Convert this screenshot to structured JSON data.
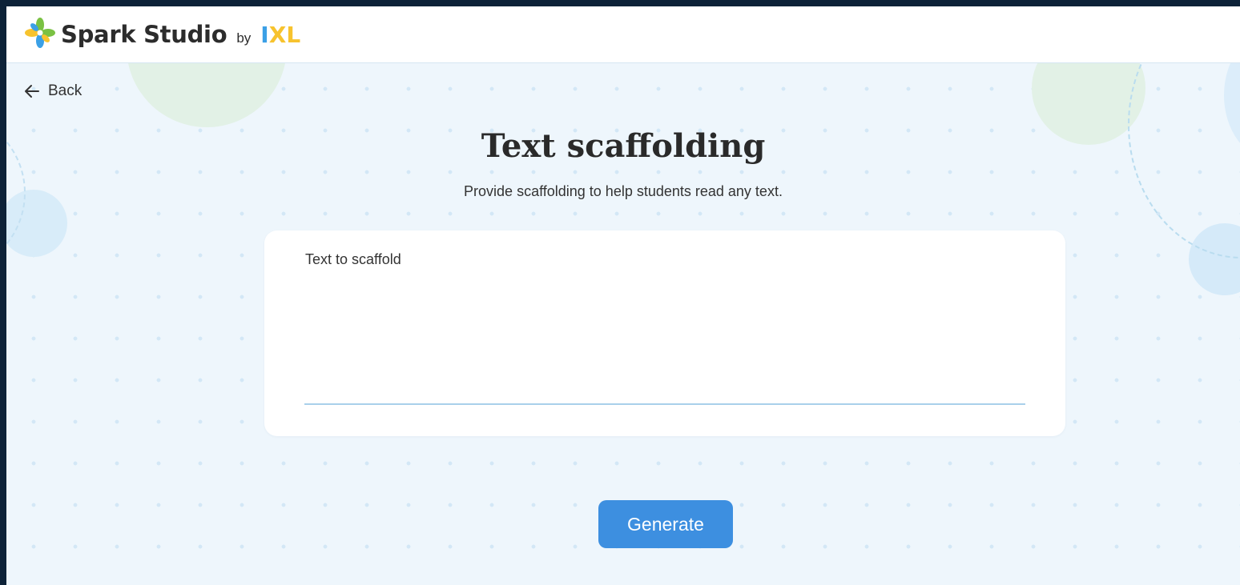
{
  "header": {
    "brand_name": "Spark Studio",
    "brand_by": "by",
    "partner_logo": {
      "letters": [
        "I",
        "X",
        "L"
      ]
    }
  },
  "nav": {
    "back_label": "Back"
  },
  "page": {
    "title": "Text scaffolding",
    "subtitle": "Provide scaffolding to help students read any text."
  },
  "form": {
    "field_label": "Text to scaffold",
    "field_value": "",
    "submit_label": "Generate"
  },
  "colors": {
    "accent": "#3d8fe0",
    "brand_green": "#7ac143",
    "brand_blue": "#3ba0e6",
    "brand_yellow": "#f7c32e",
    "page_background": "#eef6fc"
  },
  "icons": [
    "spark-logo-icon",
    "arrow-left-icon"
  ]
}
